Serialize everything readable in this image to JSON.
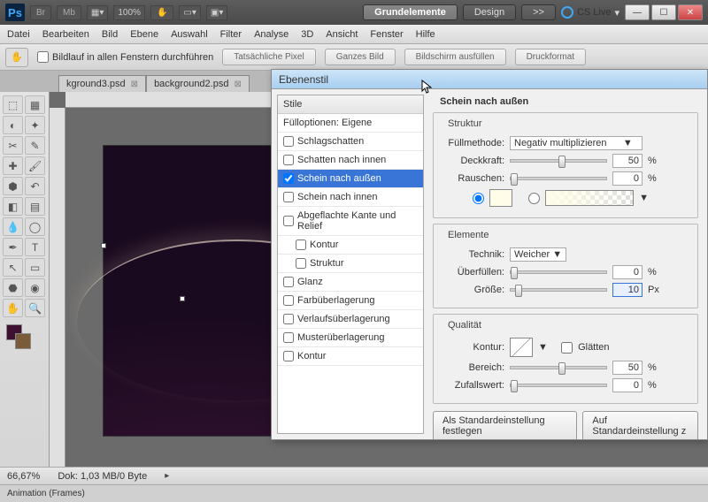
{
  "app": {
    "logo": "Ps",
    "zoom_top": "100%"
  },
  "top_buttons": {
    "br": "Br",
    "mb": "Mb"
  },
  "workspace_pills": {
    "grund": "Grundelemente",
    "design": "Design",
    "more": ">>"
  },
  "cs_live": "CS Live",
  "menu": {
    "datei": "Datei",
    "bearbeiten": "Bearbeiten",
    "bild": "Bild",
    "ebene": "Ebene",
    "auswahl": "Auswahl",
    "filter": "Filter",
    "analyse": "Analyse",
    "dd": "3D",
    "ansicht": "Ansicht",
    "fenster": "Fenster",
    "hilfe": "Hilfe"
  },
  "options": {
    "scroll_all": "Bildlauf in allen Fenstern durchführen",
    "actual": "Tatsächliche Pixel",
    "fit": "Ganzes Bild",
    "fill": "Bildschirm ausfüllen",
    "print": "Druckformat"
  },
  "tabs": {
    "t1": "kground3.psd",
    "t2": "background2.psd"
  },
  "status": {
    "zoom": "66,67%",
    "doc": "Dok: 1,03 MB/0 Byte"
  },
  "anim_panel": "Animation (Frames)",
  "dialog": {
    "title": "Ebenenstil",
    "styles_header": "Stile",
    "blend_options": "Fülloptionen: Eigene",
    "items": {
      "schlag": "Schlagschatten",
      "schatten_innen": "Schatten nach innen",
      "schein_aussen": "Schein nach außen",
      "schein_innen": "Schein nach innen",
      "abgeflachte": "Abgeflachte Kante und Relief",
      "kontur": "Kontur",
      "struktur": "Struktur",
      "glanz": "Glanz",
      "farb": "Farbüberlagerung",
      "verlauf": "Verlaufsüberlagerung",
      "muster": "Musterüberlagerung",
      "kontur2": "Kontur"
    },
    "main_heading": "Schein nach außen",
    "struktur_group": "Struktur",
    "fullmethode": "Füllmethode:",
    "fullmethode_val": "Negativ multiplizieren",
    "deckkraft": "Deckkraft:",
    "deckkraft_val": "50",
    "rauschen": "Rauschen:",
    "rauschen_val": "0",
    "elemente_group": "Elemente",
    "technik": "Technik:",
    "technik_val": "Weicher",
    "uberfullen": "Überfüllen:",
    "uberfullen_val": "0",
    "grosse": "Größe:",
    "grosse_val": "10",
    "px": "Px",
    "pct": "%",
    "qualitat_group": "Qualität",
    "kontur_label": "Kontur:",
    "glatten": "Glätten",
    "bereich": "Bereich:",
    "bereich_val": "50",
    "zufall": "Zufallswert:",
    "zufall_val": "0",
    "btn_default": "Als Standardeinstellung festlegen",
    "btn_reset": "Auf Standardeinstellung z"
  }
}
